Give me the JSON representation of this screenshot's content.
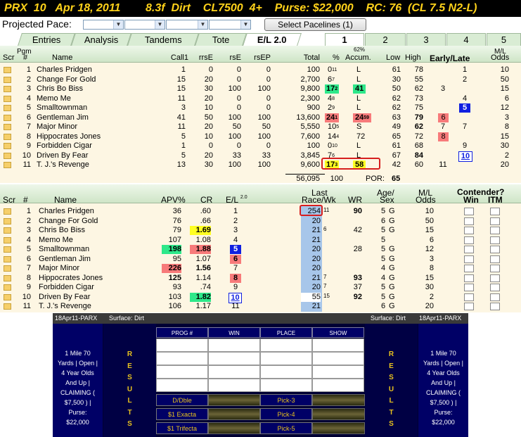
{
  "header": {
    "title": "PRX  10   Apr 18, 2011        8.3f  Dirt    CL7500  4+    Purse: $22,000    RC: 76  (CL 7.5 N2-L)"
  },
  "pace": {
    "label": "Projected Pace:",
    "select_button": "Select Pacelines  (1)"
  },
  "tabs": [
    "Entries",
    "Analysis",
    "Tandems",
    "Tote",
    "E/L 2.0"
  ],
  "race_tabs": [
    "1",
    "2",
    "3",
    "4",
    "5"
  ],
  "top_table": {
    "headers": {
      "scr": "Scr",
      "pgm": "Pgm",
      "num": "#",
      "name": "Name",
      "call1": "Call1",
      "rrse": "rrsE",
      "rse": "rsE",
      "rsep": "rsEP",
      "total": "Total",
      "pct": "%",
      "accum_pct": "62%",
      "accum": "Accum.",
      "low": "Low",
      "high": "High",
      "early_late": "Early/Late",
      "ml": "M/L",
      "odds": "Odds"
    },
    "rows": [
      {
        "num": "1",
        "name": "Charles Pridgen",
        "call1": "1",
        "rrse": "0",
        "rse": "0",
        "rsep": "0",
        "total": "100",
        "pct": "0",
        "pct_sup": "11",
        "accum": "L",
        "low": "61",
        "high": "78",
        "early": "",
        "late": "1",
        "odds": "10"
      },
      {
        "num": "2",
        "name": "Change For Gold",
        "call1": "15",
        "rrse": "20",
        "rse": "0",
        "rsep": "0",
        "total": "2,700",
        "pct": "6",
        "pct_sup": "7",
        "accum": "L",
        "low": "30",
        "high": "55",
        "early": "",
        "late": "2",
        "odds": "50"
      },
      {
        "num": "3",
        "name": "Chris Bo Biss",
        "call1": "15",
        "rrse": "30",
        "rse": "100",
        "rsep": "100",
        "total": "9,800",
        "pct": "17",
        "pct_sup": "2",
        "accum": "41",
        "low": "50",
        "high": "62",
        "early": "3",
        "late": "",
        "odds": "15"
      },
      {
        "num": "4",
        "name": "Memo Me",
        "call1": "11",
        "rrse": "20",
        "rse": "0",
        "rsep": "0",
        "total": "2,300",
        "pct": "4",
        "pct_sup": "8",
        "accum": "L",
        "low": "62",
        "high": "73",
        "early": "",
        "late": "4",
        "odds": "6"
      },
      {
        "num": "5",
        "name": "Smalltownman",
        "call1": "3",
        "rrse": "10",
        "rse": "0",
        "rsep": "0",
        "total": "900",
        "pct": "2",
        "pct_sup": "9",
        "accum": "L",
        "low": "62",
        "high": "75",
        "early": "",
        "late": "5",
        "odds": "12"
      },
      {
        "num": "6",
        "name": "Gentleman Jim",
        "call1": "41",
        "rrse": "50",
        "rse": "100",
        "rsep": "100",
        "total": "13,600",
        "pct": "24",
        "pct_sup": "1",
        "accum": "24",
        "accum_sup": "59",
        "low": "63",
        "high": "79",
        "early": "6",
        "late": "",
        "odds": "3"
      },
      {
        "num": "7",
        "name": "Major Minor",
        "call1": "11",
        "rrse": "20",
        "rse": "50",
        "rsep": "50",
        "total": "5,550",
        "pct": "10",
        "pct_sup": "5",
        "accum": "S",
        "low": "49",
        "high": "62",
        "early": "7",
        "late": "7",
        "odds": "8"
      },
      {
        "num": "8",
        "name": "Hippocrates Jones",
        "call1": "5",
        "rrse": "10",
        "rse": "100",
        "rsep": "100",
        "total": "7,600",
        "pct": "14",
        "pct_sup": "4",
        "accum": "72",
        "low": "65",
        "high": "72",
        "early": "8",
        "late": "",
        "odds": "15"
      },
      {
        "num": "9",
        "name": "Forbidden Cigar",
        "call1": "1",
        "rrse": "0",
        "rse": "0",
        "rsep": "0",
        "total": "100",
        "pct": "0",
        "pct_sup": "10",
        "accum": "L",
        "low": "61",
        "high": "68",
        "early": "",
        "late": "9",
        "odds": "30"
      },
      {
        "num": "10",
        "name": "Driven By Fear",
        "call1": "5",
        "rrse": "20",
        "rse": "33",
        "rsep": "33",
        "total": "3,845",
        "pct": "7",
        "pct_sup": "6",
        "accum": "L",
        "low": "67",
        "high": "84",
        "early": "",
        "late": "10",
        "odds": "2"
      },
      {
        "num": "11",
        "name": "T. J.'s Revenge",
        "call1": "13",
        "rrse": "30",
        "rse": "100",
        "rsep": "100",
        "total": "9,600",
        "pct": "17",
        "pct_sup": "3",
        "accum": "58",
        "low": "42",
        "high": "60",
        "early": "11",
        "late": "",
        "odds": "20"
      }
    ],
    "totals": {
      "total": "56,095",
      "pct": "100",
      "por_label": "POR:",
      "por": "65"
    }
  },
  "mid_table": {
    "headers": {
      "scr": "Scr",
      "num": "#",
      "name": "Name",
      "apv": "APV%",
      "cr": "CR",
      "el": "E/L",
      "el_sup": "2.0",
      "last": "Last",
      "racewk": "Race/Wk",
      "wr": "WR",
      "agesex": "Age/",
      "agesex2": "Sex",
      "ml": "M/L",
      "odds": "Odds",
      "contender": "Contender?",
      "win": "Win",
      "itm": "ITM"
    },
    "rows": [
      {
        "num": "1",
        "name": "Charles Pridgen",
        "apv": "36",
        "cr": ".60",
        "el": "1",
        "race": "254",
        "wk": "11",
        "wr": "90",
        "age": "5",
        "sex": "G",
        "odds": "10"
      },
      {
        "num": "2",
        "name": "Change For Gold",
        "apv": "76",
        "cr": ".66",
        "el": "2",
        "race": "20",
        "wk": "",
        "wr": "",
        "age": "6",
        "sex": "G",
        "odds": "50"
      },
      {
        "num": "3",
        "name": "Chris Bo Biss",
        "apv": "79",
        "cr": "1.69",
        "el": "3",
        "race": "21",
        "wk": "6",
        "wr": "42",
        "age": "5",
        "sex": "G",
        "odds": "15"
      },
      {
        "num": "4",
        "name": "Memo Me",
        "apv": "107",
        "cr": "1.08",
        "el": "4",
        "race": "21",
        "wk": "",
        "wr": "",
        "age": "5",
        "sex": "",
        "odds": "6"
      },
      {
        "num": "5",
        "name": "Smalltownman",
        "apv": "198",
        "cr": "1.88",
        "el": "5",
        "race": "20",
        "wk": "",
        "wr": "28",
        "age": "5",
        "sex": "G",
        "odds": "12"
      },
      {
        "num": "6",
        "name": "Gentleman Jim",
        "apv": "95",
        "cr": "1.07",
        "el": "6",
        "race": "20",
        "wk": "",
        "wr": "",
        "age": "5",
        "sex": "G",
        "odds": "3"
      },
      {
        "num": "7",
        "name": "Major Minor",
        "apv": "226",
        "cr": "1.56",
        "el": "7",
        "race": "20",
        "wk": "",
        "wr": "",
        "age": "4",
        "sex": "G",
        "odds": "8"
      },
      {
        "num": "8",
        "name": "Hippocrates Jones",
        "apv": "125",
        "cr": "1.14",
        "el": "8",
        "race": "21",
        "wk": "7",
        "wr": "93",
        "age": "4",
        "sex": "G",
        "odds": "15"
      },
      {
        "num": "9",
        "name": "Forbidden Cigar",
        "apv": "93",
        "cr": ".74",
        "el": "9",
        "race": "20",
        "wk": "7",
        "wr": "37",
        "age": "5",
        "sex": "G",
        "odds": "30"
      },
      {
        "num": "10",
        "name": "Driven By Fear",
        "apv": "103",
        "cr": "1.82",
        "el": "10",
        "race": "55",
        "wk": "15",
        "wr": "92",
        "age": "5",
        "sex": "G",
        "odds": "2"
      },
      {
        "num": "11",
        "name": "T. J.'s Revenge",
        "apv": "106",
        "cr": "1.17",
        "el": "11",
        "race": "21",
        "wk": "",
        "wr": "",
        "age": "6",
        "sex": "G",
        "odds": "20"
      }
    ]
  },
  "results": {
    "date_left": "18Apr11-PARX",
    "surface_left": "Surface: Dirt",
    "surface_right": "Surface: Dirt",
    "date_right": "18Apr11-PARX",
    "race_info": [
      "1 Mile 70",
      "Yards | Open |",
      "4 Year Olds",
      "And Up |",
      "CLAIMING (",
      "$7,500 ) |",
      "Purse:",
      "$22,000"
    ],
    "results_letters": [
      "R",
      "E",
      "S",
      "U",
      "L",
      "T",
      "S"
    ],
    "cols": [
      "PROG #",
      "WIN",
      "PLACE",
      "SHOW"
    ],
    "bets_left": [
      "D/Dble",
      "$1 Exacta",
      "$1 Trifecta"
    ],
    "bets_right": [
      "Pick-3",
      "Pick-4",
      "Pick-5"
    ]
  },
  "colors": {
    "green": "#2ee88a",
    "yellow": "#ffff22",
    "red": "#f77a7a",
    "blue": "#1020e0",
    "lightblue": "#a7c6ea"
  }
}
